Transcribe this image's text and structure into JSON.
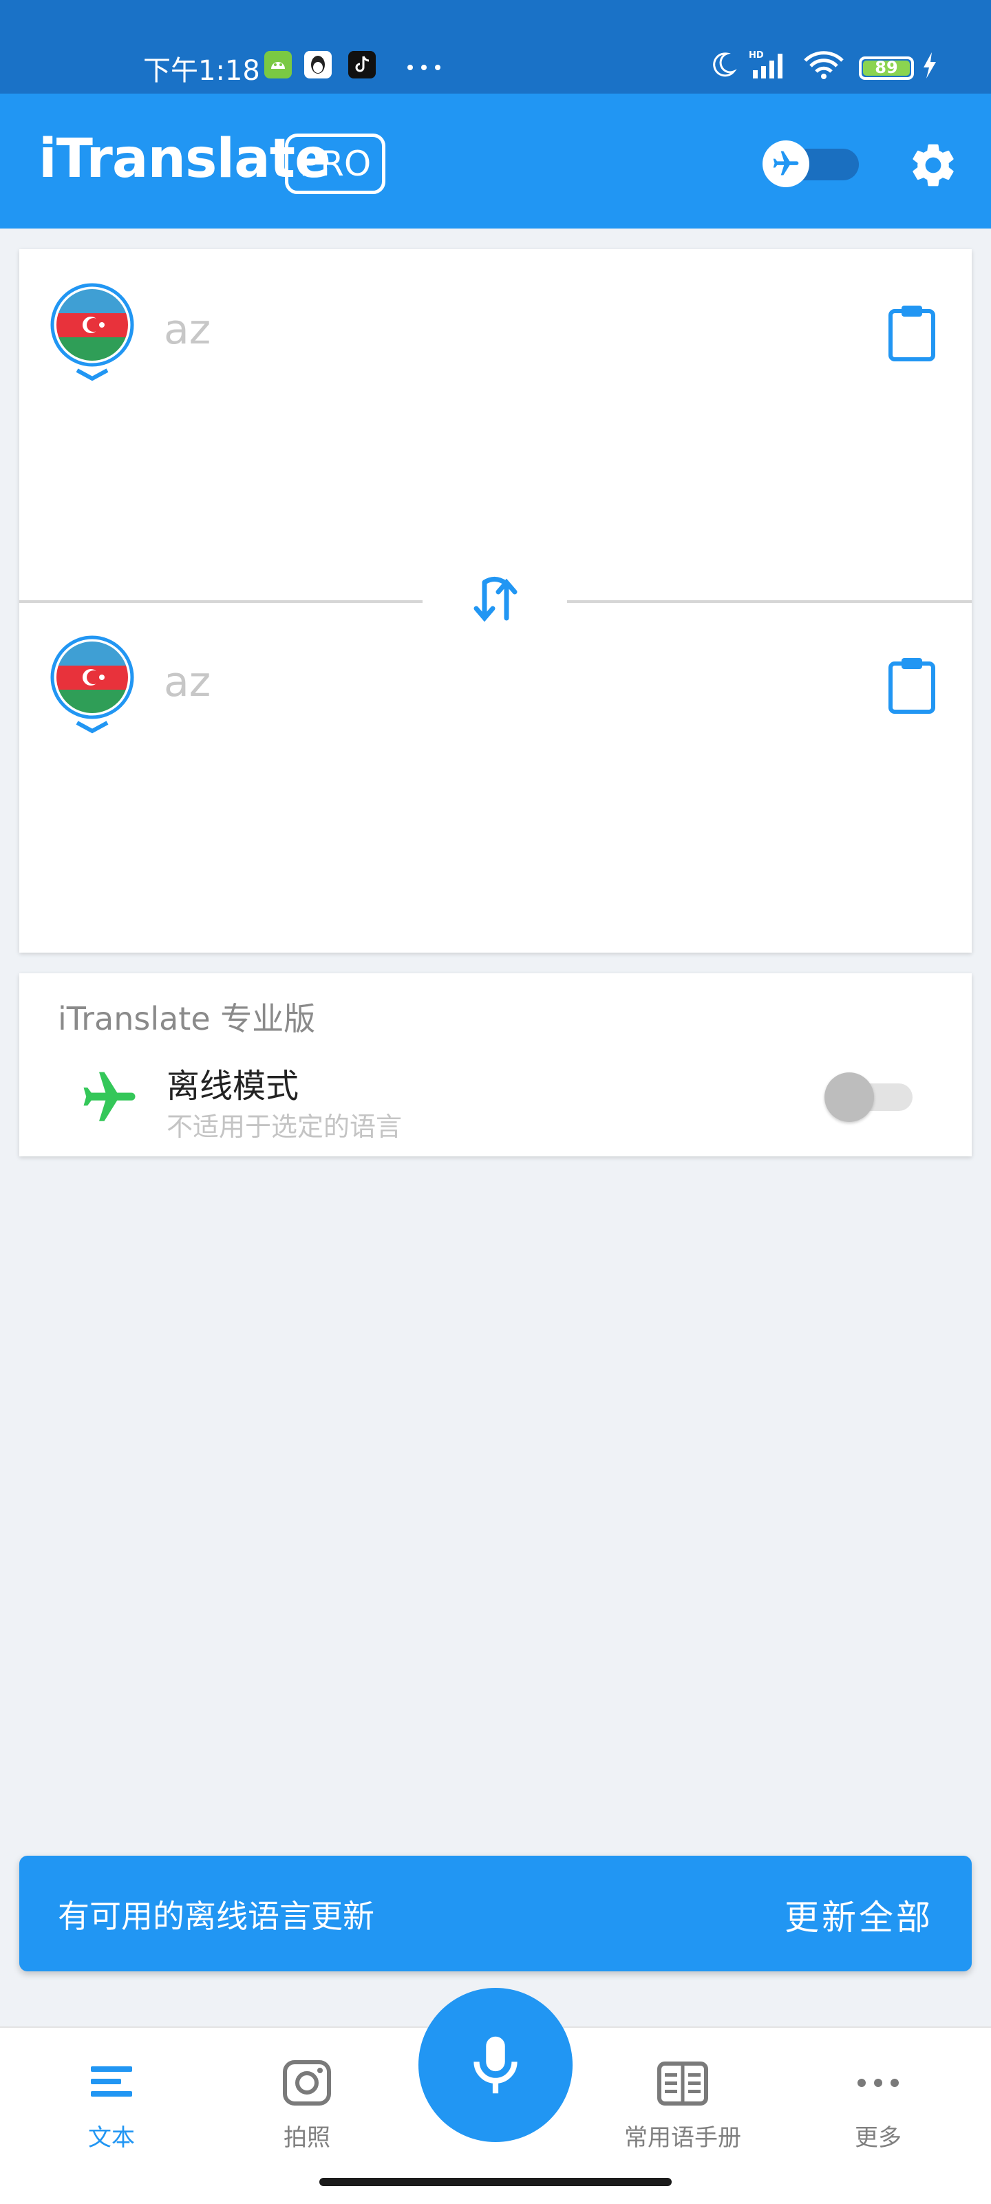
{
  "status_bar": {
    "time": "下午1:18",
    "battery": "89",
    "icons": [
      "android-icon",
      "qq-icon",
      "tiktok-icon",
      "more-dots-icon",
      "moon-icon",
      "hd-signal-icon",
      "wifi-icon",
      "battery-icon",
      "charging-icon"
    ]
  },
  "header": {
    "brand": "iTranslate",
    "badge": "PRO",
    "offline_toggle_icon": "airplane-icon",
    "settings_icon": "gear-icon"
  },
  "translator": {
    "source": {
      "flag": "azerbaijan-flag-icon",
      "lang_code": "az"
    },
    "target": {
      "flag": "azerbaijan-flag-icon",
      "lang_code": "az"
    },
    "swap_icon": "swap-arrows-icon",
    "clipboard_icon": "clipboard-icon"
  },
  "pro_card": {
    "title": "iTranslate 专业版",
    "offline_title": "离线模式",
    "offline_subtitle": "不适用于选定的语言"
  },
  "snackbar": {
    "message": "有可用的离线语言更新",
    "action": "更新全部"
  },
  "bottom_nav": {
    "items": [
      {
        "label": "文本",
        "icon": "text-lines-icon",
        "active": true
      },
      {
        "label": "拍照",
        "icon": "camera-icon",
        "active": false
      },
      {
        "label": "常用语手册",
        "icon": "phrasebook-icon",
        "active": false
      },
      {
        "label": "更多",
        "icon": "more-dots-icon",
        "active": false
      }
    ],
    "mic_icon": "microphone-icon"
  },
  "colors": {
    "status_bar": "#1a72c7",
    "primary": "#2196f3",
    "background": "#eff2f6",
    "offline_plane": "#34c759"
  }
}
